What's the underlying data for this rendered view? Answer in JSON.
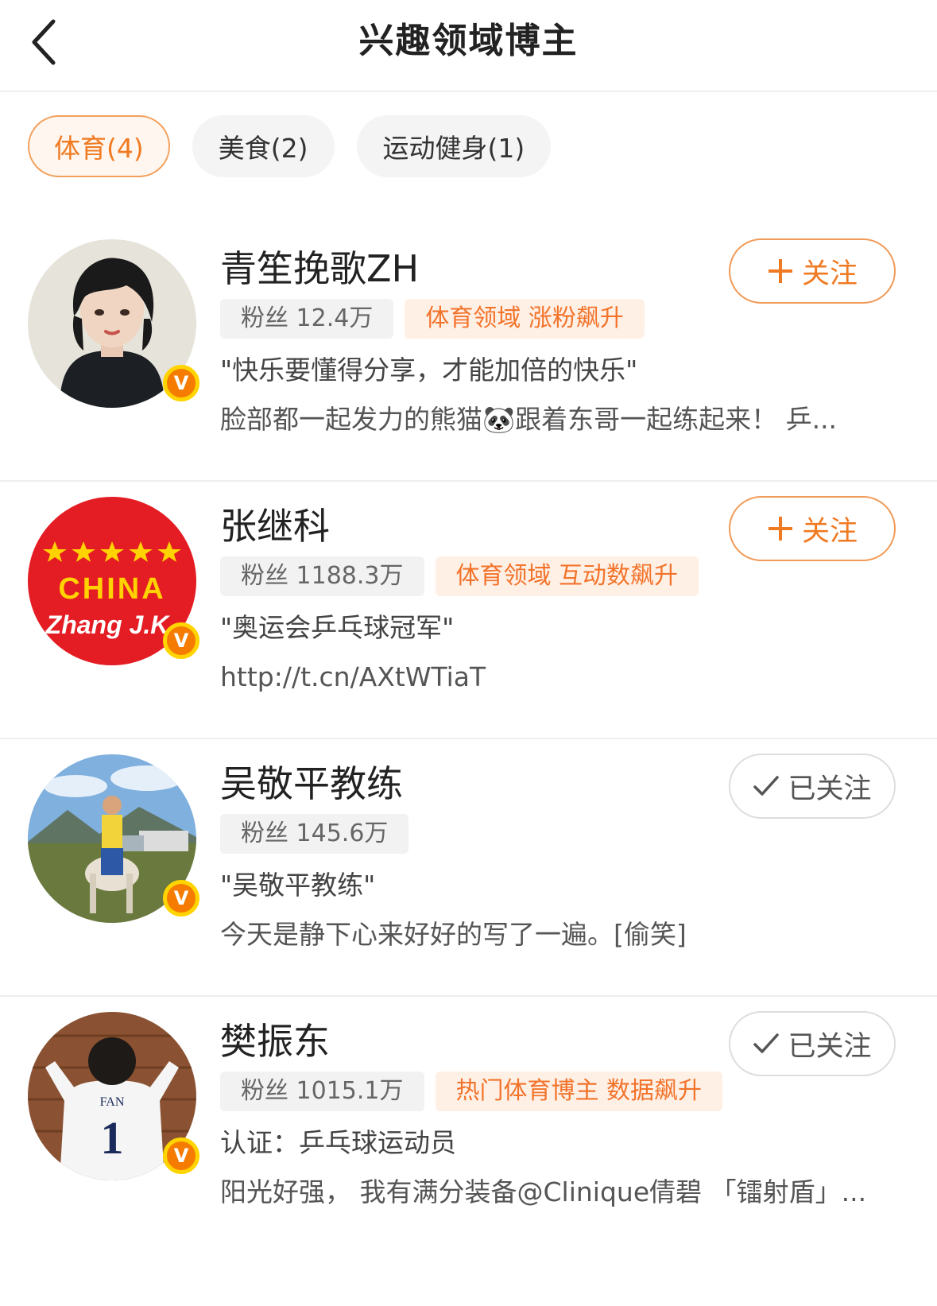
{
  "header": {
    "title": "兴趣领域博主"
  },
  "tabs": [
    {
      "label": "体育(4)"
    },
    {
      "label": "美食(2)"
    },
    {
      "label": "运动健身(1)"
    }
  ],
  "cards": [
    {
      "name": "青笙挽歌ZH",
      "fans": "粉丝 12.4万",
      "tag": "体育领域 涨粉飙升",
      "line1": "\"快乐要懂得分享，才能加倍的快乐\"",
      "line2": "脸部都一起发力的熊猫🐼跟着东哥一起练起来！ 乒...",
      "follow_label": "关注"
    },
    {
      "name": "张继科",
      "fans": "粉丝 1188.3万",
      "tag": "体育领域 互动数飙升",
      "line1": "\"奥运会乒乓球冠军\"",
      "line2": "http://t.cn/AXtWTiaT",
      "follow_label": "关注",
      "avatar_text": {
        "line1": "CHINA",
        "line2": "Zhang J.K"
      }
    },
    {
      "name": "吴敬平教练",
      "fans": "粉丝 145.6万",
      "line1": "\"吴敬平教练\"",
      "line2": "今天是静下心来好好的写了一遍。[偷笑]",
      "follow_label": "已关注"
    },
    {
      "name": "樊振东",
      "fans": "粉丝 1015.1万",
      "tag": "热门体育博主 数据飙升",
      "line1": "认证：乒乓球运动员",
      "line2": "阳光好强， 我有满分装备@Clinique倩碧 「镭射盾」...",
      "follow_label": "已关注",
      "avatar_text": {
        "jersey_name": "FAN",
        "jersey_number": "1"
      }
    }
  ],
  "badge": {
    "letter": "V"
  },
  "colors": {
    "accent": "#f07a22",
    "badge_fill": "#f57c00",
    "badge_ring": "#ffd400"
  }
}
